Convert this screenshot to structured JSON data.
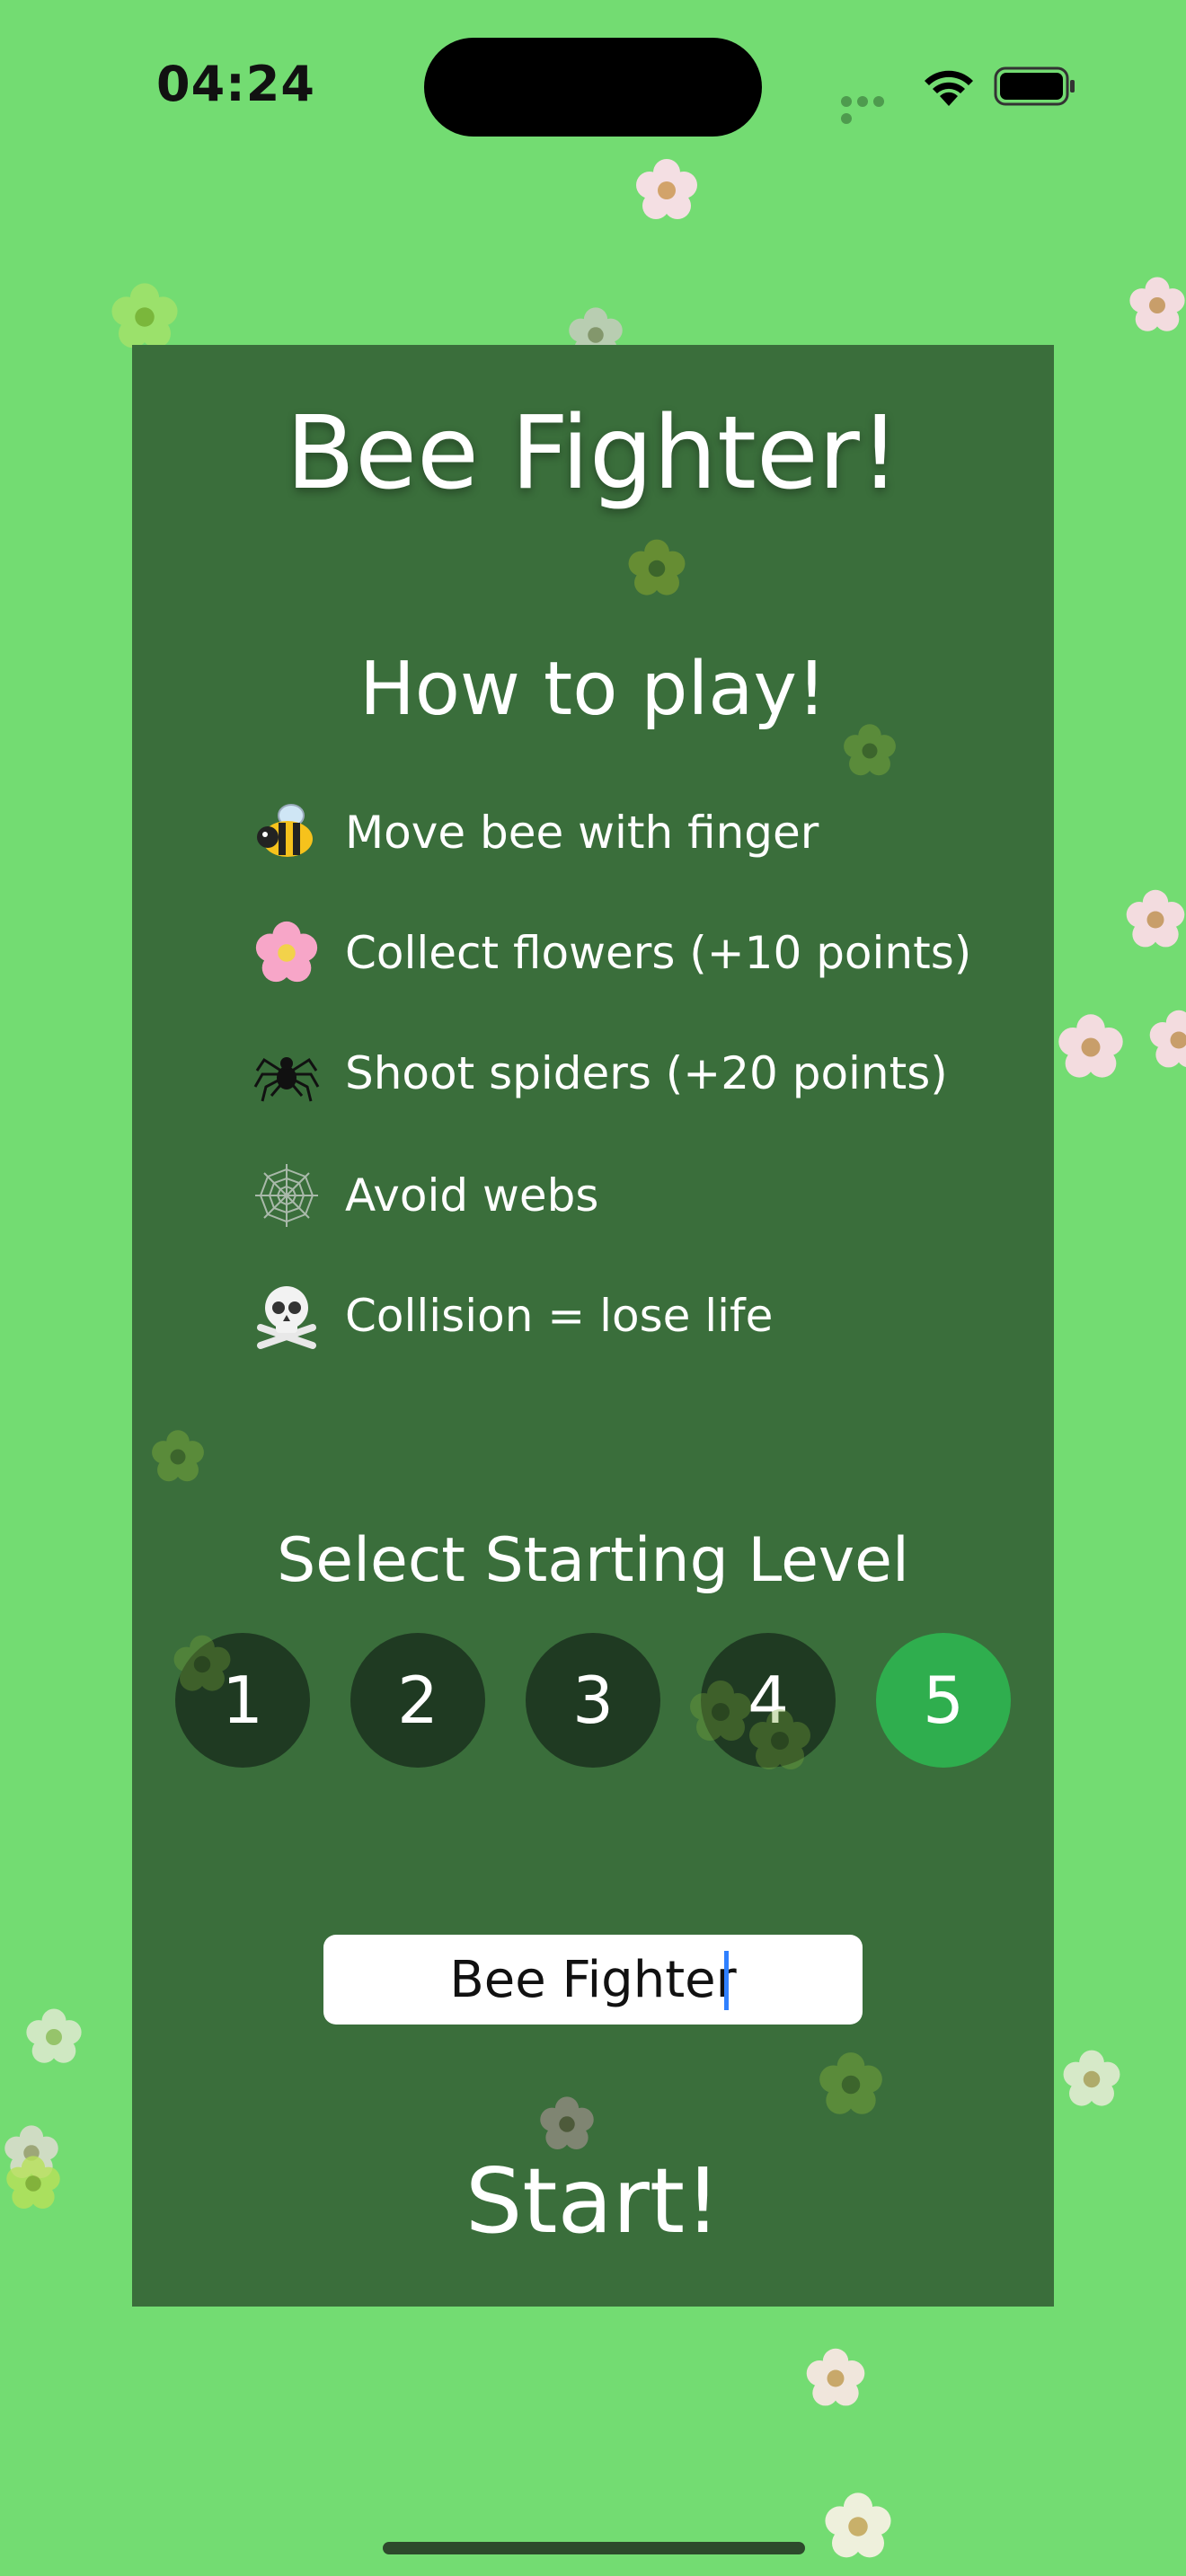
{
  "status_bar": {
    "time": "04:24"
  },
  "title": "Bee Fighter!",
  "how_to_play": {
    "heading": "How to play!",
    "rules": [
      {
        "icon": "bee-icon",
        "text": "Move bee with finger"
      },
      {
        "icon": "flower-icon",
        "text": "Collect flowers (+10 points)"
      },
      {
        "icon": "spider-icon",
        "text": "Shoot spiders (+20 points)"
      },
      {
        "icon": "web-icon",
        "text": "Avoid webs"
      },
      {
        "icon": "skull-icon",
        "text": "Collision = lose life"
      }
    ]
  },
  "level_select": {
    "heading": "Select Starting Level",
    "levels": [
      "1",
      "2",
      "3",
      "4",
      "5"
    ],
    "selected": "5"
  },
  "name_field": {
    "value": "Bee Fighter"
  },
  "start_label": "Start!",
  "colors": {
    "background": "#73dc72",
    "panel": "#3a6e3b",
    "level_button": "#1f3a22",
    "level_selected": "#2fae4e"
  }
}
